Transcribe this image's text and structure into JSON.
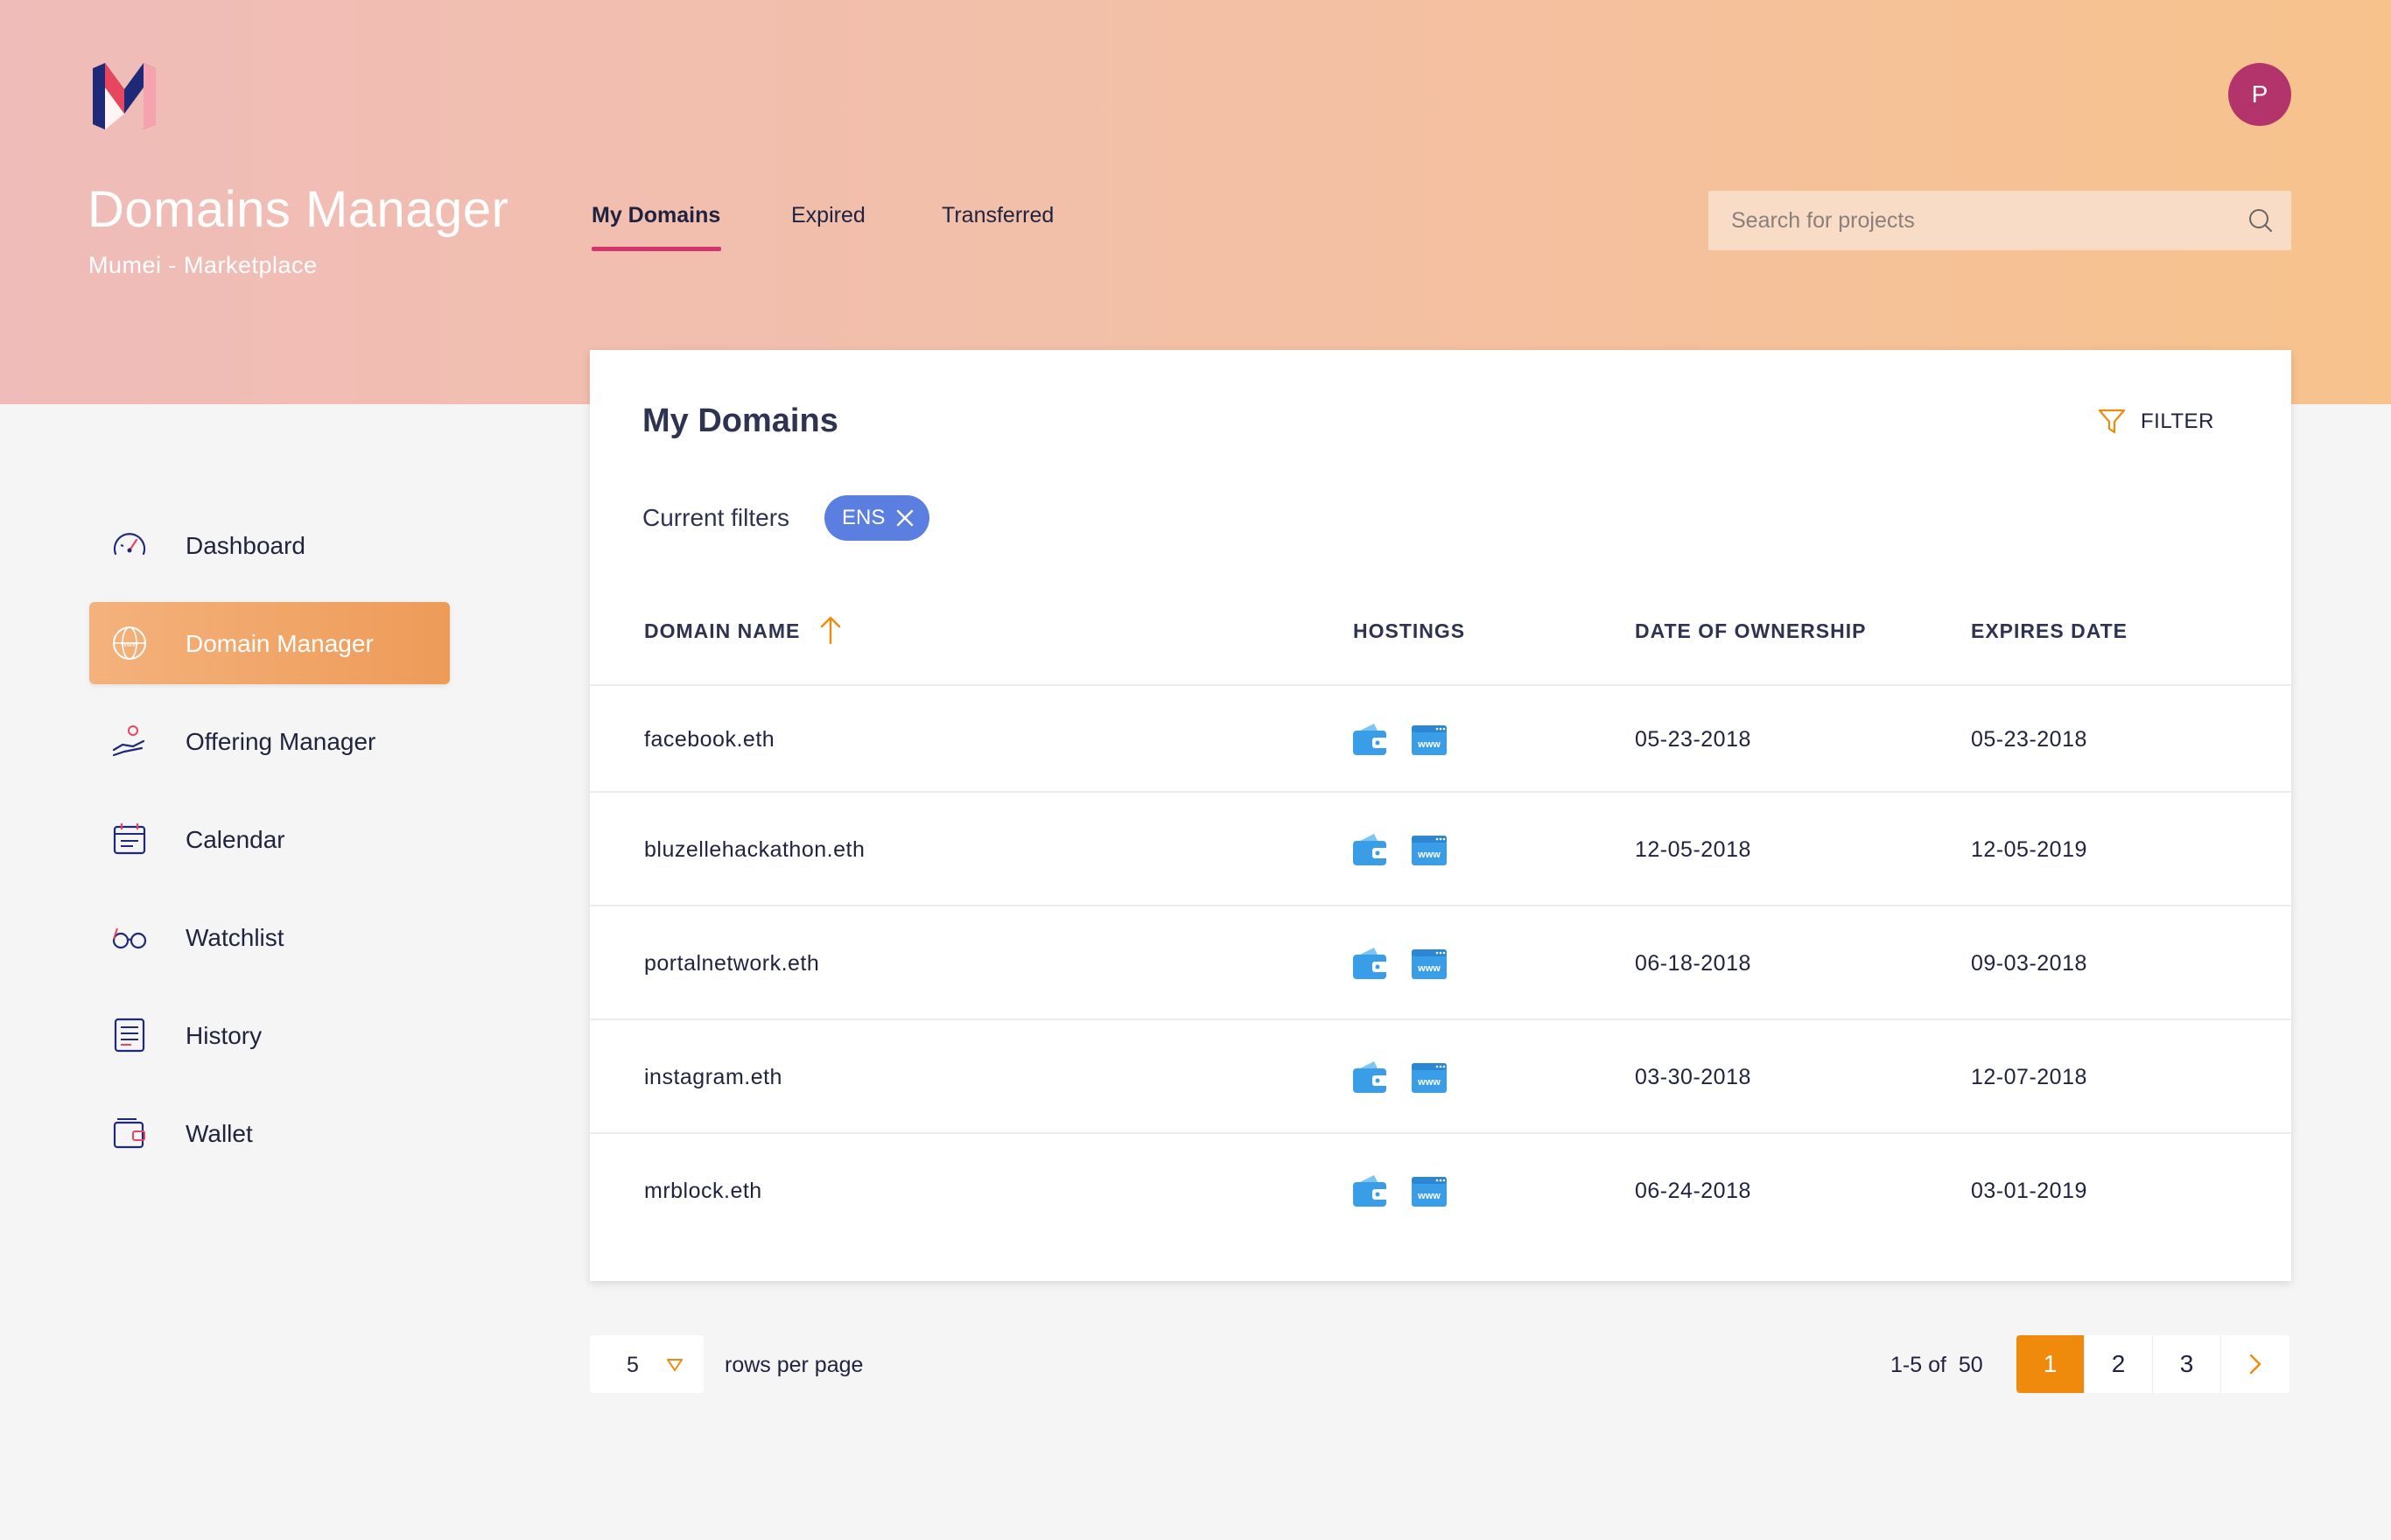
{
  "header": {
    "title": "Domains Manager",
    "subtitle": "Mumei - Marketplace",
    "avatar_initial": "P",
    "logo": "m-logo",
    "tabs": [
      {
        "label": "My Domains",
        "active": true
      },
      {
        "label": "Expired",
        "active": false
      },
      {
        "label": "Transferred",
        "active": false
      }
    ],
    "search": {
      "placeholder": "Search for projects",
      "value": "",
      "icon": "search-icon"
    }
  },
  "sidebar": {
    "items": [
      {
        "label": "Dashboard",
        "icon": "speedometer-icon",
        "active": false
      },
      {
        "label": "Domain Manager",
        "icon": "globe-www-icon",
        "active": true
      },
      {
        "label": "Offering Manager",
        "icon": "hand-coin-icon",
        "active": false
      },
      {
        "label": "Calendar",
        "icon": "calendar-icon",
        "active": false
      },
      {
        "label": "Watchlist",
        "icon": "glasses-icon",
        "active": false
      },
      {
        "label": "History",
        "icon": "document-list-icon",
        "active": false
      },
      {
        "label": "Wallet",
        "icon": "wallet-icon",
        "active": false
      }
    ]
  },
  "main": {
    "title": "My Domains",
    "filter_label": "FILTER",
    "current_filters_label": "Current filters",
    "filter_chip": "ENS",
    "table": {
      "columns": [
        "DOMAIN NAME",
        "HOSTINGS",
        "DATE OF OWNERSHIP",
        "EXPIRES DATE"
      ],
      "rows": [
        {
          "domain": "facebook.eth",
          "owned": "05-23-2018",
          "expires": "05-23-2018"
        },
        {
          "domain": "bluzellehackathon.eth",
          "owned": "12-05-2018",
          "expires": "12-05-2019"
        },
        {
          "domain": "portalnetwork.eth",
          "owned": "06-18-2018",
          "expires": "09-03-2018"
        },
        {
          "domain": "instagram.eth",
          "owned": "03-30-2018",
          "expires": "12-07-2018"
        },
        {
          "domain": "mrblock.eth",
          "owned": "06-24-2018",
          "expires": "03-01-2019"
        }
      ],
      "hosting_icons": [
        "wallet-hosting-icon",
        "www-hosting-icon"
      ]
    }
  },
  "pagination": {
    "rows_per_page": "5",
    "rows_per_page_label": "rows per page",
    "range": "1-5 of  50",
    "pages": [
      "1",
      "2",
      "3"
    ],
    "current_page": "1"
  },
  "colors": {
    "accent": "#f08a0c",
    "tab_underline": "#d6336c",
    "avatar": "#b2346a",
    "chip": "#5b7fe0"
  }
}
